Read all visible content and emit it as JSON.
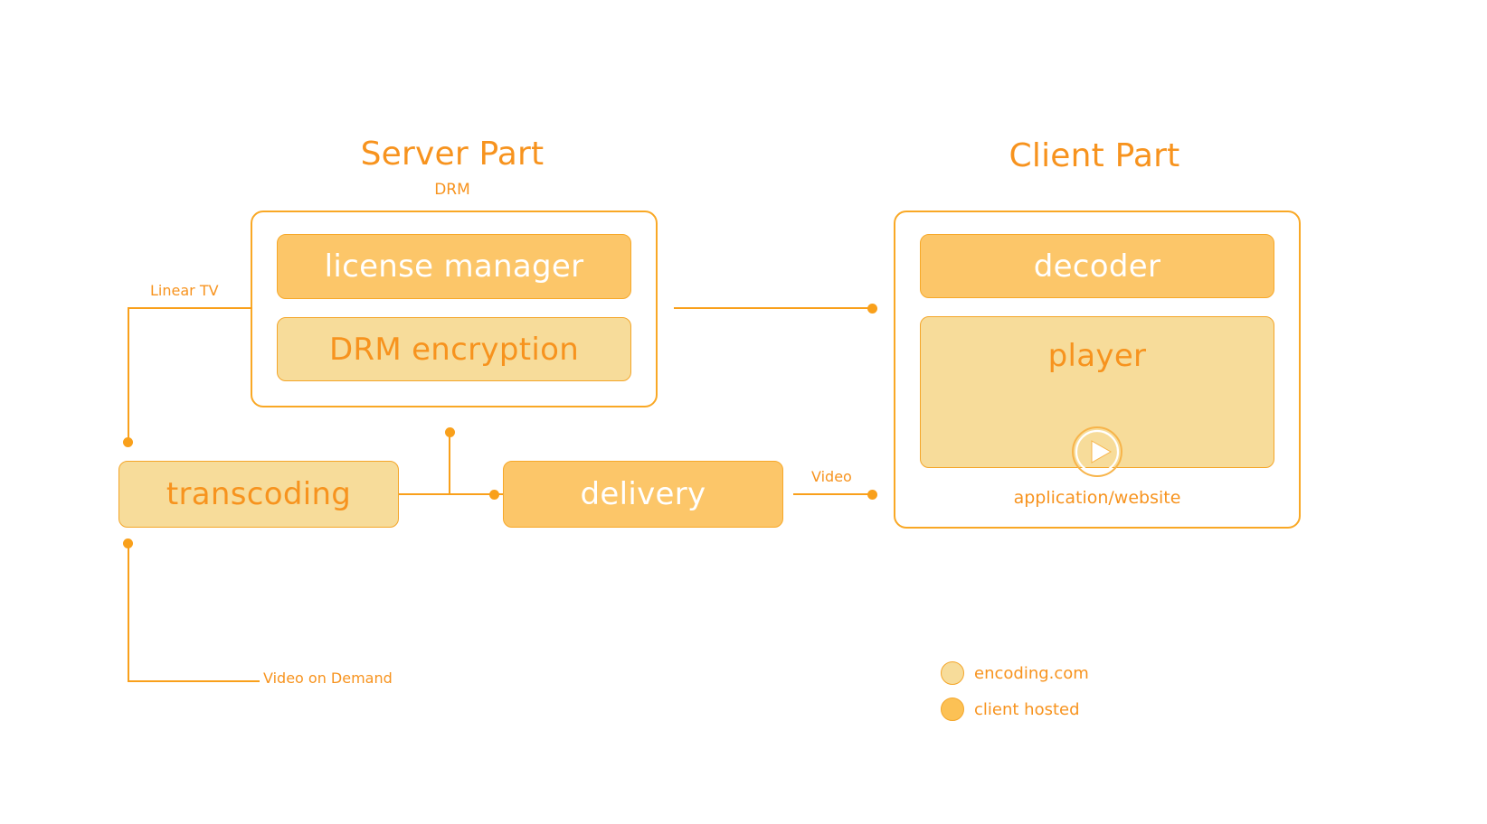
{
  "diagram": {
    "server": {
      "title": "Server Part",
      "group_label": "DRM",
      "blocks": [
        {
          "label": "license manager",
          "tone": "dark"
        },
        {
          "label": "DRM encryption",
          "tone": "light"
        }
      ]
    },
    "client": {
      "title": "Client Part",
      "footer_label": "application/website",
      "blocks": [
        {
          "label": "decoder",
          "tone": "dark"
        },
        {
          "label": "player",
          "tone": "light"
        }
      ],
      "player_icon": "play-icon"
    },
    "standalone_blocks": [
      {
        "label": "transcoding",
        "tone": "light"
      },
      {
        "label": "delivery",
        "tone": "dark"
      }
    ],
    "edge_labels": {
      "linear_tv": "Linear TV",
      "video_on_demand": "Video on Demand",
      "video": "Video"
    },
    "legend": [
      {
        "label": "encoding.com",
        "tone": "light",
        "color": "#f7dc9a"
      },
      {
        "label": "client hosted",
        "tone": "dark",
        "color": "#fcc155"
      }
    ],
    "colors": {
      "accent": "#f7931e",
      "line": "#f9a01b",
      "block_dark": "#fcc669",
      "block_light": "#f7dc9a",
      "border": "#f4a62a",
      "background": "#ffffff"
    }
  }
}
